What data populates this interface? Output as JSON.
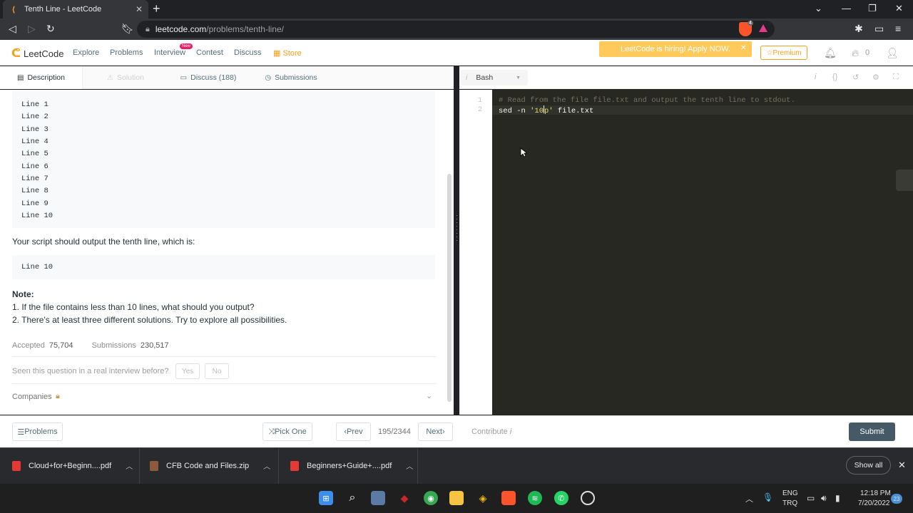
{
  "browser": {
    "tab_title": "Tenth Line - LeetCode",
    "url_host": "leetcode.com",
    "url_path": "/problems/tenth-line/",
    "brave_badge": "4"
  },
  "nav": {
    "logo": "LeetCode",
    "links": [
      "Explore",
      "Problems",
      "Interview",
      "Contest",
      "Discuss",
      "Store"
    ],
    "new_badge": "New",
    "hiring": "LeetCode is hiring! Apply NOW.",
    "premium": "Premium",
    "streak": "0"
  },
  "tabs": {
    "description": "Description",
    "solution": "Solution",
    "discuss": "Discuss (188)",
    "submissions": "Submissions"
  },
  "problem": {
    "file_lines": [
      "Line 1",
      "Line 2",
      "Line 3",
      "Line 4",
      "Line 5",
      "Line 6",
      "Line 7",
      "Line 8",
      "Line 9",
      "Line 10"
    ],
    "output_text": "Your script should output the tenth line, which is:",
    "output_value": "Line 10",
    "note_title": "Note:",
    "note_1": "1. If the file contains less than 10 lines, what should you output?",
    "note_2": "2. There's at least three different solutions. Try to explore all possibilities.",
    "accepted_label": "Accepted",
    "accepted_value": "75,704",
    "submissions_label": "Submissions",
    "submissions_value": "230,517",
    "seen_question": "Seen this question in a real interview before?",
    "yes": "Yes",
    "no": "No",
    "companies": "Companies"
  },
  "editor": {
    "language": "Bash",
    "line_numbers": [
      "1",
      "2"
    ],
    "line1": "# Read from the file file.txt and output the tenth line to stdout.",
    "line2_cmd": "sed -n ",
    "line2_str_a": "'10",
    "line2_str_b": "p'",
    "line2_rest": " file.txt"
  },
  "bottom": {
    "problems": "Problems",
    "pick_one": "Pick One",
    "prev": "Prev",
    "page": "195/2344",
    "next": "Next",
    "contribute": "Contribute",
    "submit": "Submit"
  },
  "downloads": {
    "items": [
      "Cloud+for+Beginn....pdf",
      "CFB Code and Files.zip",
      "Beginners+Guide+....pdf"
    ],
    "show_all": "Show all"
  },
  "taskbar": {
    "lang_top": "ENG",
    "lang_bottom": "TRQ",
    "time": "12:18 PM",
    "date": "7/20/2022",
    "notif": "23"
  }
}
